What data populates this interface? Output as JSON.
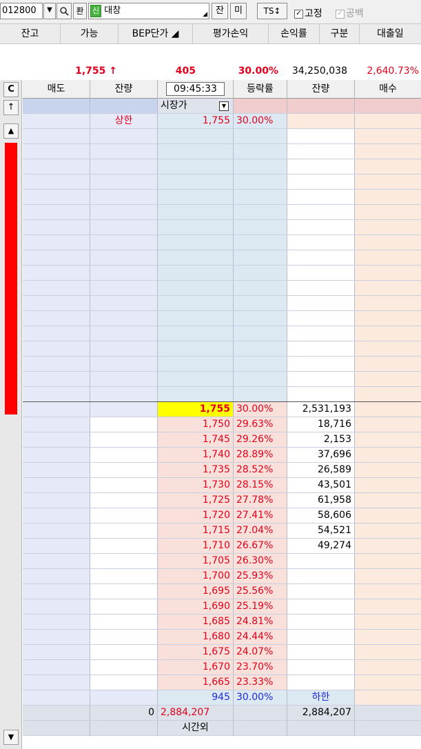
{
  "toolbar": {
    "code": "012800",
    "pan_label": "퐌",
    "shin_badge": "신",
    "stock_name": "대창",
    "jan_button": "잔",
    "mi_button": "미",
    "ts_button": "TS↕",
    "fixed_label": "고정",
    "blank_label": "공백"
  },
  "header": [
    "잔고",
    "가능",
    "BEP단가 ◢",
    "평가손익",
    "손익률",
    "구분",
    "대출일"
  ],
  "summary": {
    "price": "1,755 ↑",
    "change": "405",
    "rate": "30.00%",
    "volume": "34,250,038",
    "turnover": "2,640.73%"
  },
  "strip": {
    "c_label": "C",
    "up_arrow": "↑",
    "scroll_up": "▲",
    "scroll_down": "▼",
    "accent_color": "#ff0000"
  },
  "book": {
    "columns": [
      "매도",
      "잔량",
      "09:45:33",
      "등락률",
      "잔량",
      "매수"
    ],
    "market_price_label": "시장가",
    "upper_limit_label": "상한",
    "upper_price": "1,755",
    "upper_rate": "30.00%",
    "bids": [
      {
        "price": "1,755",
        "rate": "30.00%",
        "qty": "2,531,193"
      },
      {
        "price": "1,750",
        "rate": "29.63%",
        "qty": "18,716"
      },
      {
        "price": "1,745",
        "rate": "29.26%",
        "qty": "2,153"
      },
      {
        "price": "1,740",
        "rate": "28.89%",
        "qty": "37,696"
      },
      {
        "price": "1,735",
        "rate": "28.52%",
        "qty": "26,589"
      },
      {
        "price": "1,730",
        "rate": "28.15%",
        "qty": "43,501"
      },
      {
        "price": "1,725",
        "rate": "27.78%",
        "qty": "61,958"
      },
      {
        "price": "1,720",
        "rate": "27.41%",
        "qty": "58,606"
      },
      {
        "price": "1,715",
        "rate": "27.04%",
        "qty": "54,521"
      },
      {
        "price": "1,710",
        "rate": "26.67%",
        "qty": "49,274"
      },
      {
        "price": "1,705",
        "rate": "26.30%",
        "qty": ""
      },
      {
        "price": "1,700",
        "rate": "25.93%",
        "qty": ""
      },
      {
        "price": "1,695",
        "rate": "25.56%",
        "qty": ""
      },
      {
        "price": "1,690",
        "rate": "25.19%",
        "qty": ""
      },
      {
        "price": "1,685",
        "rate": "24.81%",
        "qty": ""
      },
      {
        "price": "1,680",
        "rate": "24.44%",
        "qty": ""
      },
      {
        "price": "1,675",
        "rate": "24.07%",
        "qty": ""
      },
      {
        "price": "1,670",
        "rate": "23.70%",
        "qty": ""
      },
      {
        "price": "1,665",
        "rate": "23.33%",
        "qty": ""
      }
    ],
    "lower_price": "945",
    "lower_rate": "30.00%",
    "lower_limit_label": "하한",
    "total_ask": "0",
    "total_ask_qty": "2,884,207",
    "total_bid_qty": "2,884,207",
    "after_hours_label": "시간외"
  },
  "colors": {
    "current_price_bg": "#ffff00",
    "ask_bg": "#e6e9f7",
    "bid_bg": "#fbeadd",
    "price_bid_bg": "#f9e0da",
    "price_ask_bg": "#dce8f2"
  }
}
